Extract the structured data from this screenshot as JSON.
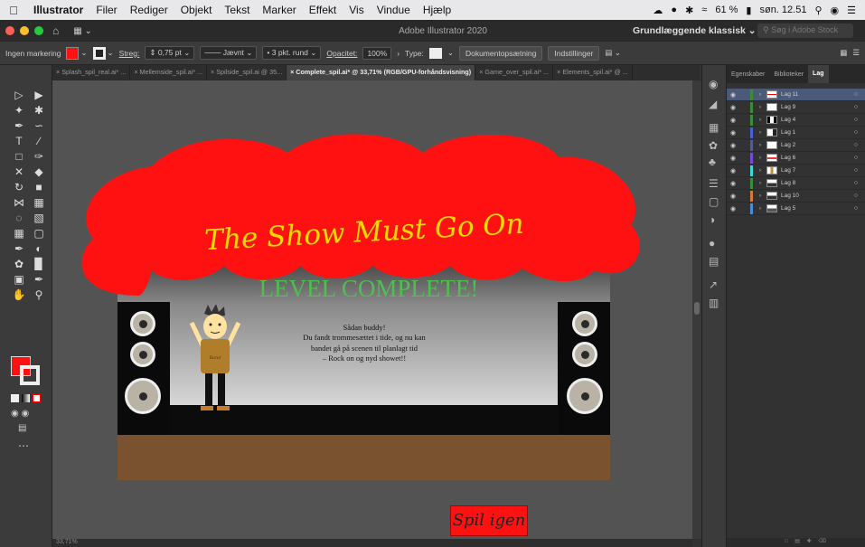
{
  "menubar": {
    "app_name": "Illustrator",
    "items": [
      "Filer",
      "Rediger",
      "Objekt",
      "Tekst",
      "Marker",
      "Effekt",
      "Vis",
      "Vindue",
      "Hjælp"
    ],
    "battery": "61 %",
    "clock": "søn. 12.51"
  },
  "titlebar": {
    "title": "Adobe Illustrator 2020",
    "workspace": "Grundlæggende klassisk",
    "search_placeholder": "Søg i Adobe Stock"
  },
  "controlbar": {
    "selection": "Ingen markering",
    "stroke_label": "Streg:",
    "stroke_value": "0,75 pt",
    "profile": "Jævnt",
    "brush": "3 pkt. rund",
    "opacity_label": "Opacitet:",
    "opacity_value": "100%",
    "type_label": "Type:",
    "doc_setup_button": "Dokumentopsætning",
    "preferences_button": "Indstillinger"
  },
  "tabs": [
    {
      "label": "Splash_spil_real.ai* ..."
    },
    {
      "label": "Mellemside_spil.ai* ..."
    },
    {
      "label": "Spilside_spil.ai @ 35..."
    },
    {
      "label": "Complete_spil.ai* @ 33,71% (RGB/GPU-forhåndsvisning)"
    },
    {
      "label": "Game_over_spil.ai* ..."
    },
    {
      "label": "Elements_spil.ai* @ ..."
    }
  ],
  "artwork": {
    "title": "The Show Must Go On",
    "level_complete": "LEVEL COMPLETE!",
    "message_line1": "Sådan buddy!",
    "message_line2": "Du fandt trommesættet i tide, og nu kan",
    "message_line3": "bandet gå på scenen til planlagt tid",
    "message_line4": "– Rock on og nyd showet!!",
    "shirt_text": "Band",
    "play_again": "Spil igen"
  },
  "status": {
    "zoom": "33,71%"
  },
  "layers_panel": {
    "tabs": [
      "Egenskaber",
      "Biblioteker",
      "Lag"
    ],
    "active_tab": "Lag",
    "layers": [
      {
        "name": "Lag 11",
        "color": "#3b8d3b"
      },
      {
        "name": "Lag 9",
        "color": "#3b8d3b"
      },
      {
        "name": "Lag 4",
        "color": "#3b8d3b"
      },
      {
        "name": "Lag 1",
        "color": "#4b5fd8"
      },
      {
        "name": "Lag 2",
        "color": "#5a5a8c"
      },
      {
        "name": "Lag 6",
        "color": "#7a4bd8"
      },
      {
        "name": "Lag 7",
        "color": "#3bd8d8"
      },
      {
        "name": "Lag 8",
        "color": "#3b8d3b"
      },
      {
        "name": "Lag 10",
        "color": "#d87a3b"
      },
      {
        "name": "Lag 5",
        "color": "#4b8dd8"
      }
    ]
  },
  "colors": {
    "curtain": "#ff1111",
    "title_yellow": "#ffd500",
    "level_green": "#4fbf4f",
    "floor_brown": "#7a5230"
  }
}
